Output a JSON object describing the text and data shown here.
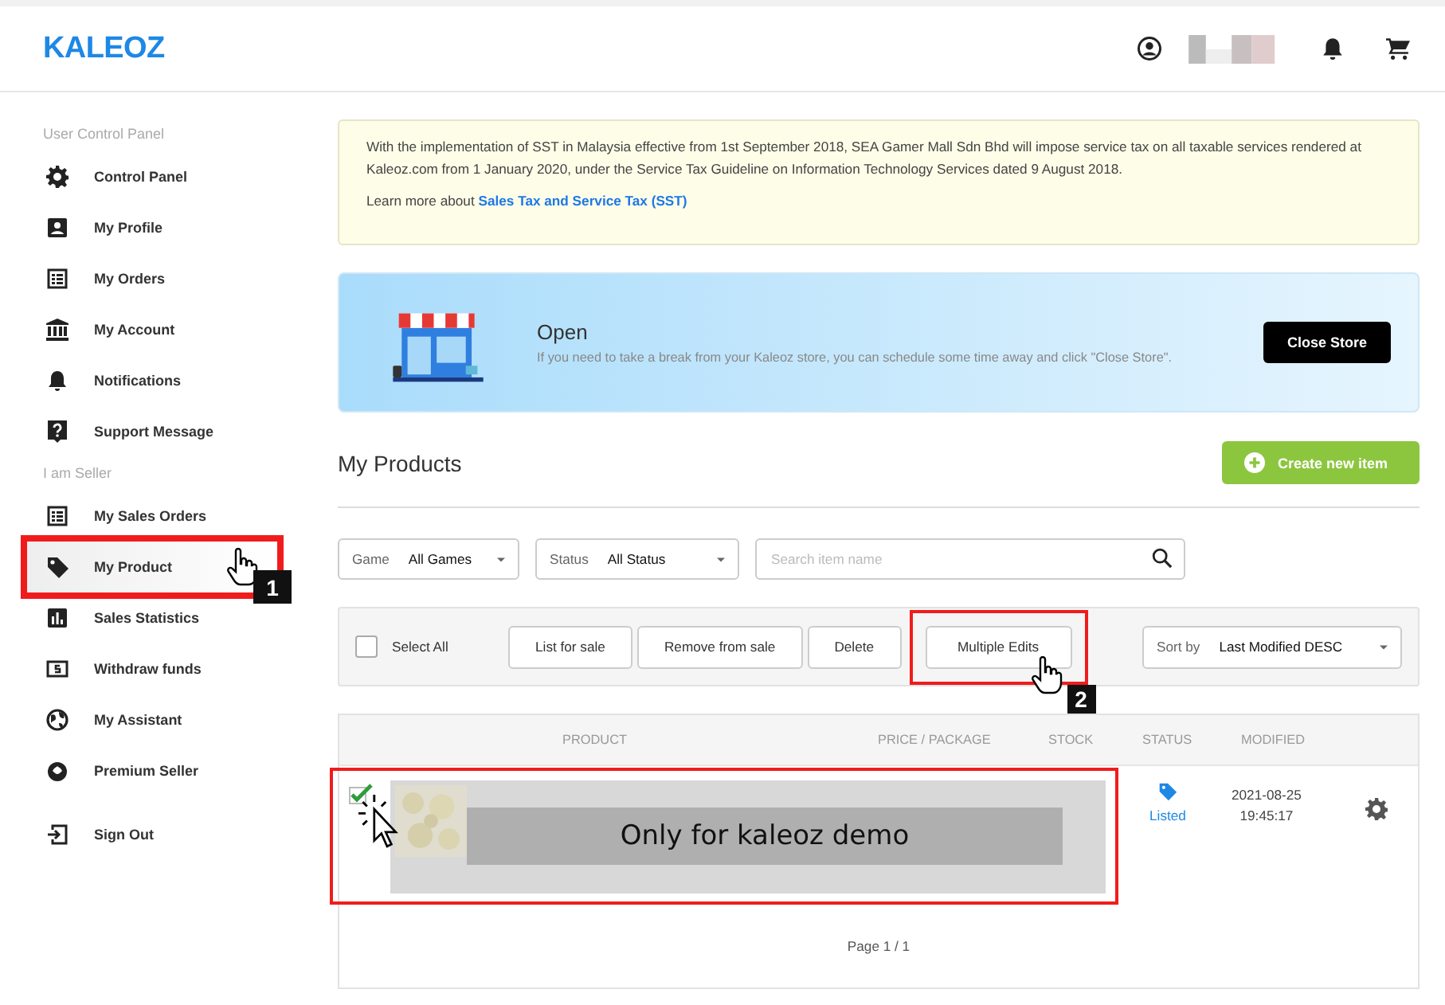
{
  "header": {
    "logo": "KALEOZ"
  },
  "sidebar": {
    "sections": [
      {
        "title": "User Control Panel",
        "items": [
          {
            "label": "Control Panel",
            "selected": false
          },
          {
            "label": "My Profile",
            "selected": false
          },
          {
            "label": "My Orders",
            "selected": false
          },
          {
            "label": "My Account",
            "selected": false
          },
          {
            "label": "Notifications",
            "selected": false
          },
          {
            "label": "Support Message",
            "selected": false
          }
        ]
      },
      {
        "title": "I am Seller",
        "items": [
          {
            "label": "My Sales Orders",
            "selected": false
          },
          {
            "label": "My Product",
            "selected": true,
            "callout": "1"
          },
          {
            "label": "Sales Statistics",
            "selected": false
          },
          {
            "label": "Withdraw funds",
            "selected": false
          },
          {
            "label": "My Assistant",
            "selected": false
          },
          {
            "label": "Premium Seller",
            "selected": false
          }
        ]
      }
    ],
    "sign_out": "Sign Out"
  },
  "notice": {
    "text": "With the implementation of SST in Malaysia effective from 1st September 2018, SEA Gamer Mall Sdn Bhd will impose service tax on all taxable services rendered at Kaleoz.com from 1 January 2020, under the Service Tax Guideline on Information Technology Services dated 9 August 2018.",
    "link_prefix": "Learn more about",
    "link": "Sales Tax and Service Tax (SST)"
  },
  "store": {
    "status": "Open",
    "message": "If you need to take a break from your Kaleoz store, you can schedule some time away and click \"Close Store\".",
    "button": "Close Store"
  },
  "products": {
    "title": "My Products",
    "create_button": "Create new item",
    "filters": [
      {
        "label": "Game",
        "value": "All Games"
      },
      {
        "label": "Status",
        "value": "All Status"
      }
    ],
    "search": {
      "placeholder": "Search item name"
    },
    "select_all": {
      "label": "Select All",
      "checked": false
    },
    "actions": [
      {
        "label": "List for sale"
      },
      {
        "label": "Remove from sale"
      },
      {
        "label": "Delete"
      },
      {
        "label": "Multiple Edits",
        "callout": "2"
      }
    ],
    "sort": {
      "label": "Sort by",
      "value": "Last Modified DESC"
    },
    "columns": [
      "PRODUCT",
      "PRICE / PACKAGE",
      "STOCK",
      "STATUS",
      "MODIFIED"
    ],
    "rows": [
      {
        "checked": true,
        "highlighted": true,
        "overlay": "Only for kaleoz demo",
        "status": "Listed",
        "modified_date": "2021-08-25",
        "modified_time": "19:45:17"
      }
    ],
    "pager": "Page 1 / 1"
  }
}
